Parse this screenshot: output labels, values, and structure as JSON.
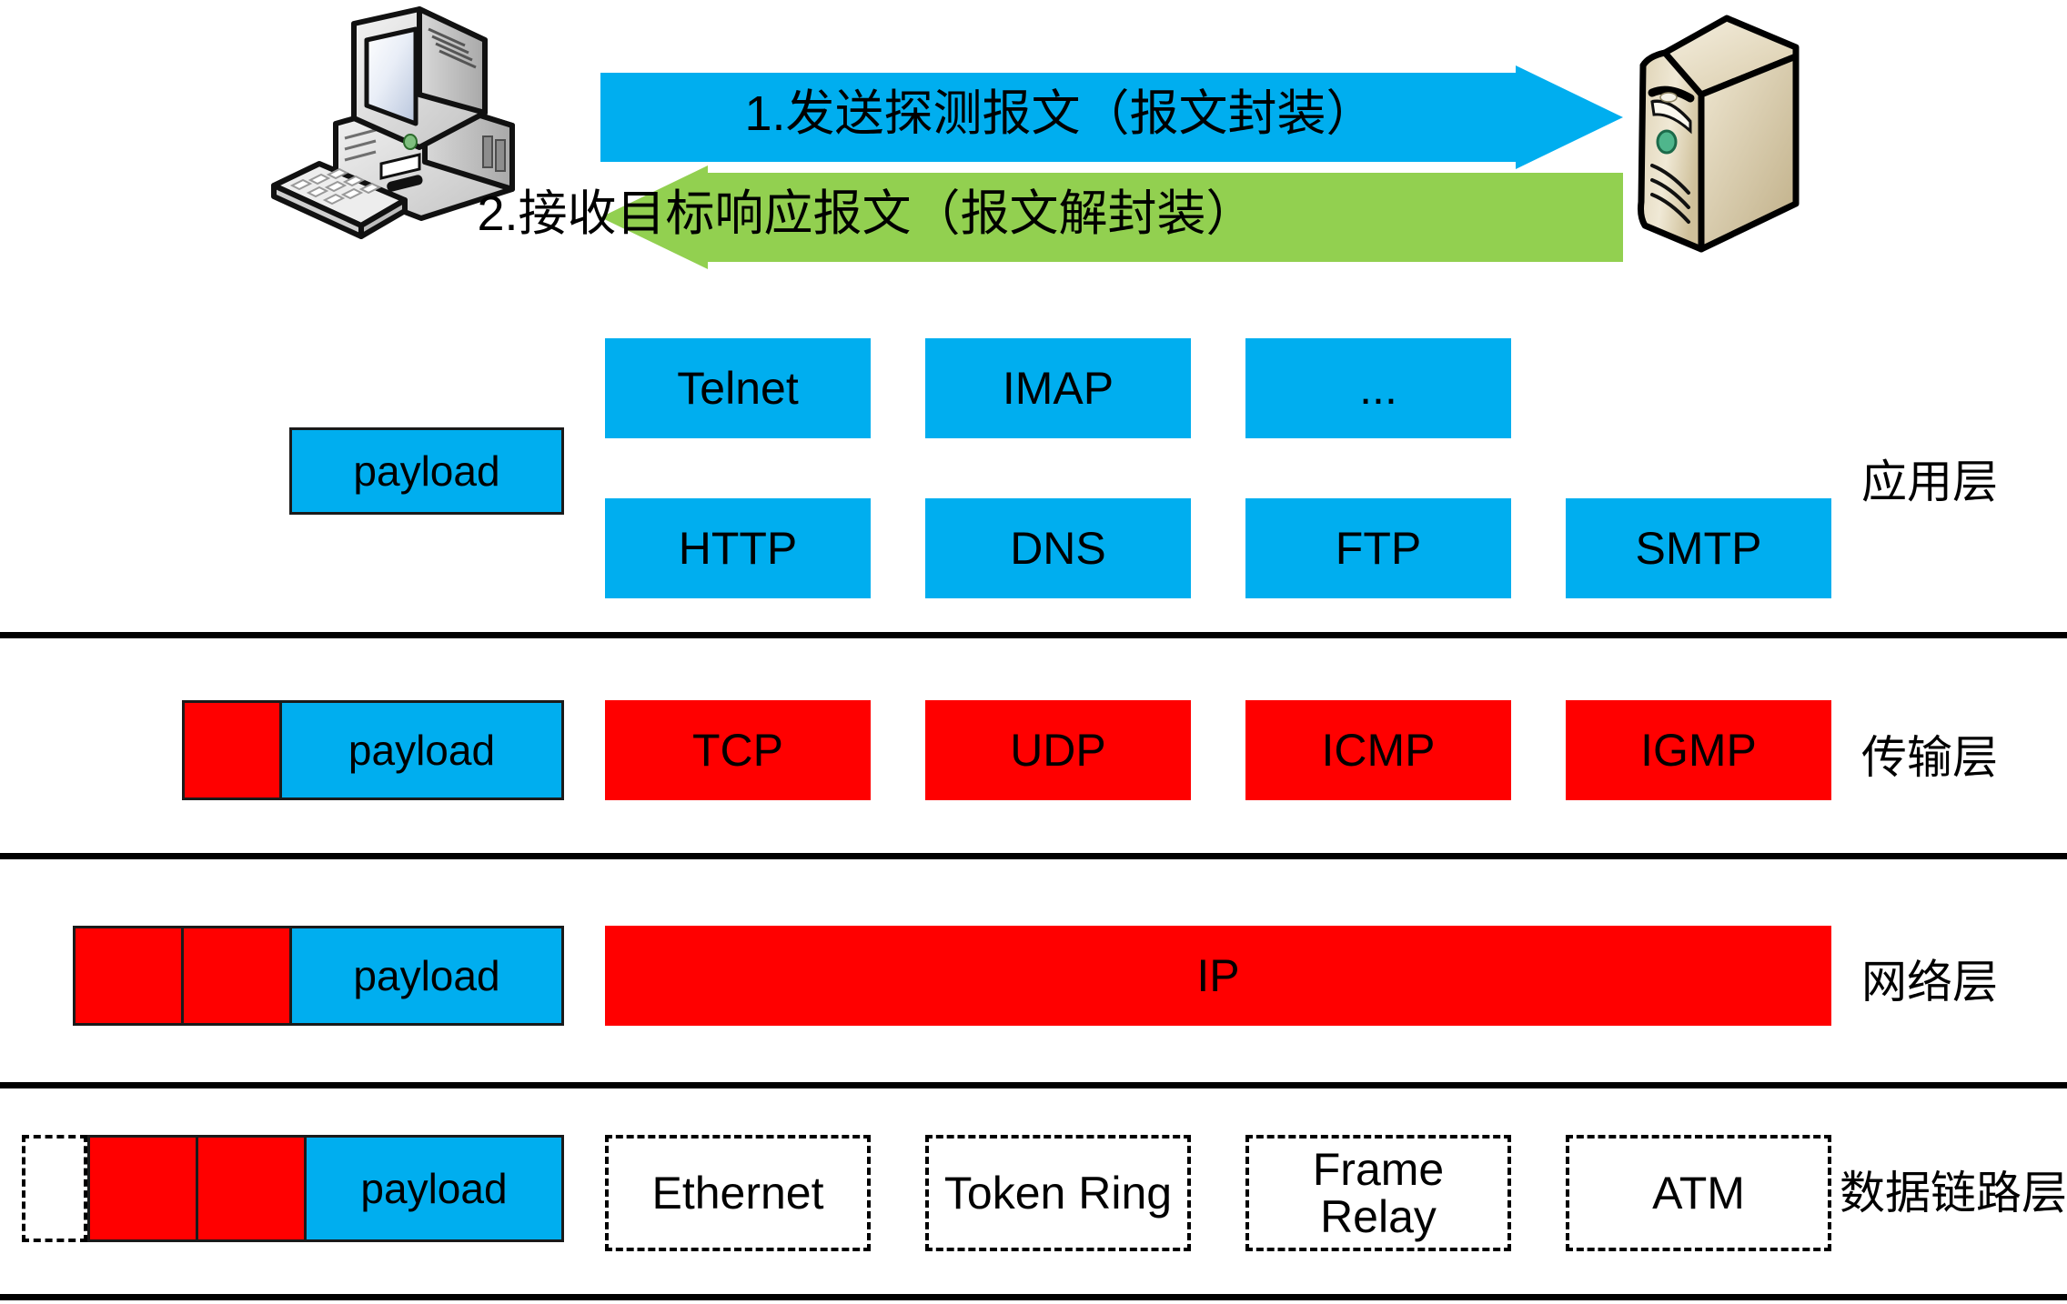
{
  "diagram": {
    "title": "TCP/IP protocol stack encapsulation diagram",
    "colors": {
      "app_blue": "#00AEEF",
      "transport_red": "#FF0000",
      "arrow_blue": "#00AEEF",
      "arrow_green": "#92D050",
      "divider_black": "#000000",
      "server_beige": "#D9CBA8",
      "led_green": "#35A86B"
    }
  },
  "flow": {
    "source_device": "desktop-computer",
    "target_device": "server-tower",
    "arrows": [
      {
        "id": "send",
        "label": "1.发送探测报文（报文封装）",
        "direction": "right",
        "color": "#00AEEF"
      },
      {
        "id": "receive",
        "label": "2.接收目标响应报文（报文解封装）",
        "direction": "left",
        "color": "#92D050"
      }
    ]
  },
  "layers": [
    {
      "id": "application",
      "name": "应用层",
      "protocols_row1": [
        "Telnet",
        "IMAP",
        "..."
      ],
      "protocols_row2": [
        "HTTP",
        "DNS",
        "FTP",
        "SMTP"
      ],
      "style": "blue"
    },
    {
      "id": "transport",
      "name": "传输层",
      "protocols": [
        "TCP",
        "UDP",
        "ICMP",
        "IGMP"
      ],
      "style": "red"
    },
    {
      "id": "network",
      "name": "网络层",
      "protocols": [
        "IP"
      ],
      "style": "red"
    },
    {
      "id": "datalink",
      "name": "数据链路层",
      "protocols": [
        "Ethernet",
        "Token Ring",
        "Frame Relay",
        "ATM"
      ],
      "style": "dashed"
    }
  ],
  "encapsulation": {
    "payload_label": "payload",
    "rows": [
      {
        "layer": "application",
        "segments": [
          "payload"
        ]
      },
      {
        "layer": "transport",
        "segments": [
          "transport-header",
          "payload"
        ]
      },
      {
        "layer": "network",
        "segments": [
          "network-header",
          "transport-header",
          "payload"
        ]
      },
      {
        "layer": "datalink",
        "segments": [
          "frame-header",
          "network-header",
          "transport-header",
          "payload"
        ]
      }
    ]
  }
}
